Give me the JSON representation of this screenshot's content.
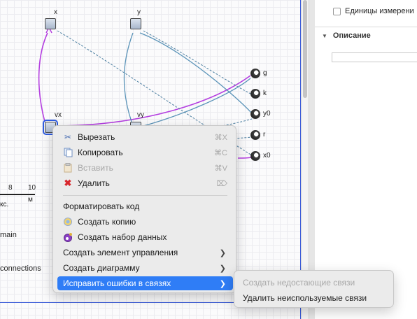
{
  "canvas": {
    "nodes": [
      {
        "label": "x"
      },
      {
        "label": "y"
      },
      {
        "label": "vx"
      },
      {
        "label": "vy"
      }
    ],
    "params": [
      {
        "label": "g"
      },
      {
        "label": "k"
      },
      {
        "label": "y0"
      },
      {
        "label": "r"
      },
      {
        "label": "x0"
      }
    ],
    "scale": {
      "tick1": "8",
      "tick2": "10",
      "unit": "м",
      "unit_cut": "кс."
    },
    "fragments": {
      "main": "main",
      "connections": "connections"
    }
  },
  "panel": {
    "checkbox_label": "Единицы измерени",
    "section_title": "Описание"
  },
  "context_menu": {
    "cut": {
      "label": "Вырезать",
      "shortcut": "⌘X"
    },
    "copy": {
      "label": "Копировать",
      "shortcut": "⌘C"
    },
    "paste": {
      "label": "Вставить",
      "shortcut": "⌘V"
    },
    "delete": {
      "label": "Удалить",
      "shortcut": "⌦"
    },
    "format_code": {
      "label": "Форматировать код"
    },
    "create_copy": {
      "label": "Создать копию"
    },
    "create_dataset": {
      "label": "Создать набор данных"
    },
    "create_control": {
      "label": "Создать элемент управления"
    },
    "create_chart": {
      "label": "Создать диаграмму"
    },
    "fix_links": {
      "label": "Исправить ошибки в связях"
    }
  },
  "submenu": {
    "create_missing": {
      "label": "Создать недостающие связи"
    },
    "remove_unused": {
      "label": "Удалить неиспользуемые связи"
    }
  },
  "colors": {
    "accent": "#2f7df6",
    "selection": "#2f5de0",
    "link_purple": "#b43ee0",
    "link_blue": "#4b8bb0"
  }
}
